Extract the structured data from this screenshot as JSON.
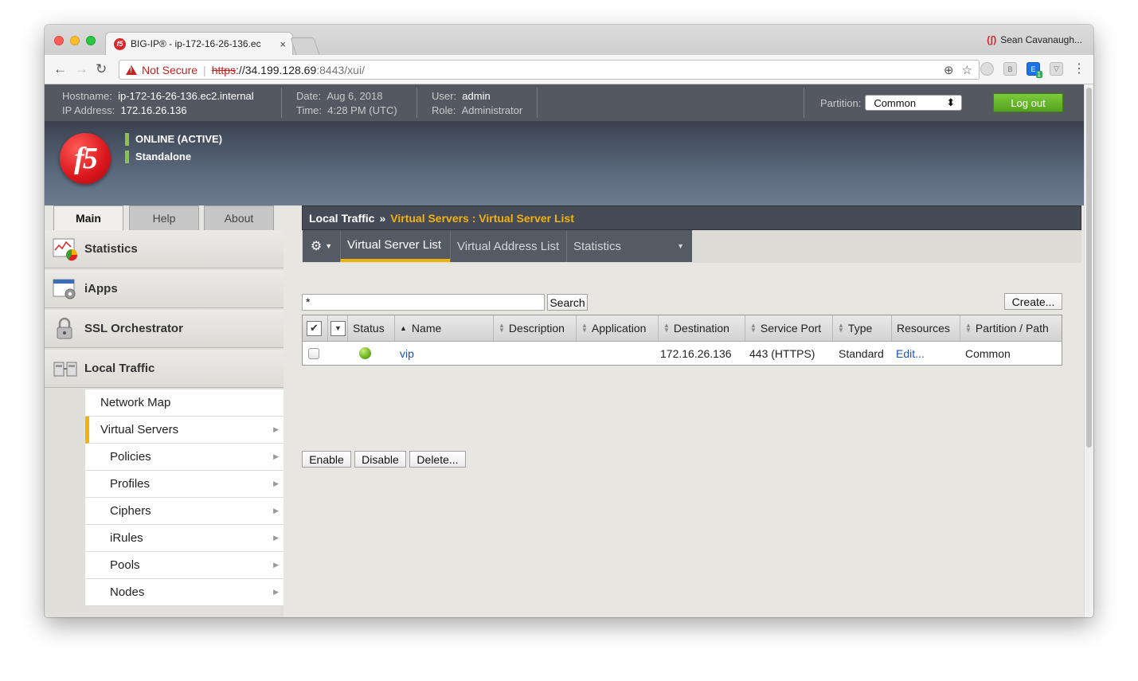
{
  "browser": {
    "tab_title": "BIG-IP® - ip-172-16-26-136.ec",
    "tab_close": "×",
    "profile_name": "Sean Cavanaugh...",
    "not_secure": "Not Secure",
    "url_scheme": "https",
    "url_host": "://34.199.128.69",
    "url_path": ":8443/xui/"
  },
  "header": {
    "hostname_label": "Hostname:",
    "hostname": "ip-172-16-26-136.ec2.internal",
    "ip_label": "IP Address:",
    "ip": "172.16.26.136",
    "date_label": "Date:",
    "date": "Aug 6, 2018",
    "time_label": "Time:",
    "time": "4:28 PM (UTC)",
    "user_label": "User:",
    "user": "admin",
    "role_label": "Role:",
    "role": "Administrator",
    "partition_label": "Partition:",
    "partition_value": "Common",
    "logout_label": "Log out"
  },
  "status": {
    "online": "ONLINE (ACTIVE)",
    "mode": "Standalone",
    "indicator_color": "#8bc34a"
  },
  "logo": {
    "text": "f5",
    "color": "#d9161b"
  },
  "left_tabs": [
    "Main",
    "Help",
    "About"
  ],
  "breadcrumb": {
    "section": "Local Traffic",
    "separator": "»",
    "current": "Virtual Servers : Virtual Server List"
  },
  "sidebar": {
    "sections": [
      {
        "label": "Statistics",
        "icon": "statistics-icon"
      },
      {
        "label": "iApps",
        "icon": "iapps-icon"
      },
      {
        "label": "SSL Orchestrator",
        "icon": "lock-icon"
      },
      {
        "label": "Local Traffic",
        "icon": "local-traffic-icon"
      }
    ],
    "items": [
      {
        "label": "Network Map"
      },
      {
        "label": "Virtual Servers"
      },
      {
        "label": "Policies"
      },
      {
        "label": "Profiles"
      },
      {
        "label": "Ciphers"
      },
      {
        "label": "iRules"
      },
      {
        "label": "Pools"
      },
      {
        "label": "Nodes"
      }
    ]
  },
  "content_tabs": [
    "Virtual Server List",
    "Virtual Address List",
    "Statistics"
  ],
  "search": {
    "value": "*",
    "button": "Search"
  },
  "create_button": "Create...",
  "table": {
    "columns": [
      "Status",
      "Name",
      "Description",
      "Application",
      "Destination",
      "Service Port",
      "Type",
      "Resources",
      "Partition / Path"
    ],
    "rows": [
      {
        "name": "vip",
        "description": "",
        "application": "",
        "destination": "172.16.26.136",
        "service_port": "443 (HTTPS)",
        "type": "Standard",
        "resources": "Edit...",
        "partition": "Common"
      }
    ]
  },
  "actions": [
    "Enable",
    "Disable",
    "Delete..."
  ],
  "colors": {
    "accent": "#f2b10c",
    "logout": "#53a21c",
    "header_bg": "#545961"
  }
}
